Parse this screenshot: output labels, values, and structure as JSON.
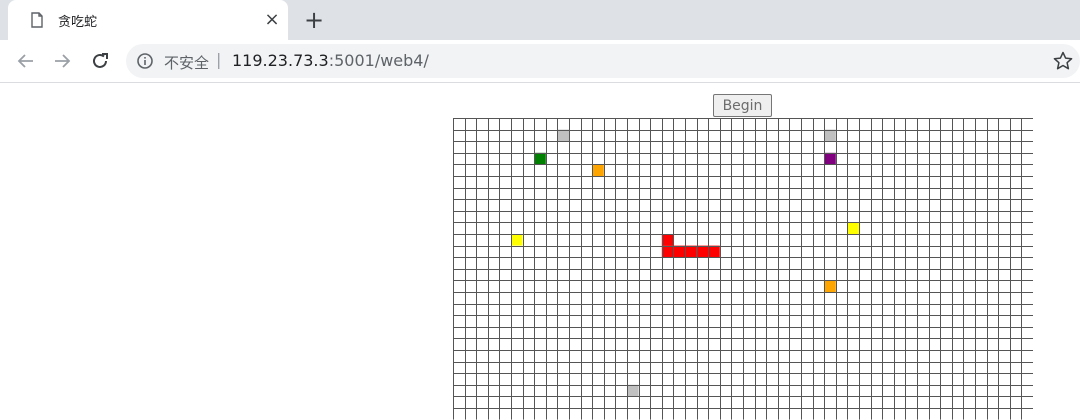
{
  "browser": {
    "tab_title": "贪吃蛇",
    "close_glyph": "×",
    "new_tab_glyph": "+",
    "security_label": "不安全",
    "separator": "|",
    "url_host": "119.23.73.3",
    "url_rest": ":5001/web4/"
  },
  "icons": {
    "tab": "document-icon",
    "back": "back-arrow-icon",
    "forward": "forward-arrow-icon",
    "reload": "reload-icon",
    "info": "info-icon",
    "bookmark": "star-icon"
  },
  "game": {
    "begin_label": "Begin",
    "colors": {
      "grid_line": "#555555",
      "snake": "#ff0000",
      "gray": "#c0c0c0",
      "green": "#008000",
      "orange": "#ffa500",
      "purple": "#800080",
      "yellow": "#ffff00"
    },
    "snake": [
      [
        18,
        10
      ],
      [
        18,
        11
      ],
      [
        19,
        11
      ],
      [
        20,
        11
      ],
      [
        21,
        11
      ],
      [
        22,
        11
      ]
    ],
    "items": [
      {
        "col": 9,
        "row": 1,
        "color": "gray"
      },
      {
        "col": 32,
        "row": 1,
        "color": "gray"
      },
      {
        "col": 7,
        "row": 3,
        "color": "green"
      },
      {
        "col": 32,
        "row": 3,
        "color": "purple"
      },
      {
        "col": 12,
        "row": 4,
        "color": "orange"
      },
      {
        "col": 34,
        "row": 9,
        "color": "yellow"
      },
      {
        "col": 5,
        "row": 10,
        "color": "yellow"
      },
      {
        "col": 32,
        "row": 14,
        "color": "orange"
      },
      {
        "col": 15,
        "row": 23,
        "color": "gray"
      }
    ]
  }
}
